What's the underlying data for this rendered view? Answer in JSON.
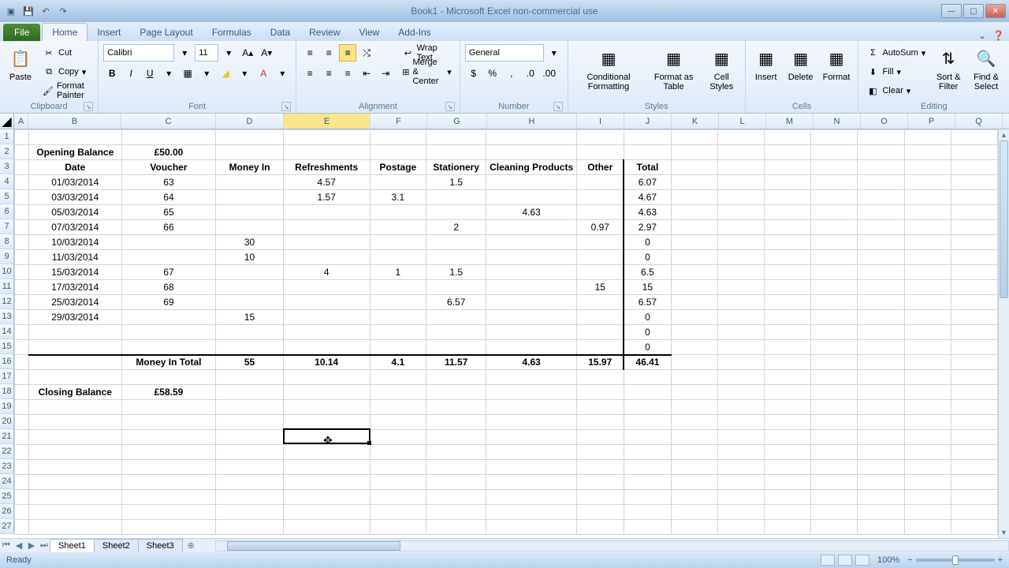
{
  "title": "Book1 - Microsoft Excel non-commercial use",
  "tabs": {
    "file": "File",
    "home": "Home",
    "insert": "Insert",
    "pageLayout": "Page Layout",
    "formulas": "Formulas",
    "data": "Data",
    "review": "Review",
    "view": "View",
    "addins": "Add-Ins"
  },
  "ribbon": {
    "clipboard": {
      "paste": "Paste",
      "cut": "Cut",
      "copy": "Copy",
      "painter": "Format Painter",
      "label": "Clipboard"
    },
    "font": {
      "name": "Calibri",
      "size": "11",
      "label": "Font"
    },
    "alignment": {
      "wrap": "Wrap Text",
      "merge": "Merge & Center",
      "label": "Alignment"
    },
    "number": {
      "format": "General",
      "label": "Number"
    },
    "styles": {
      "cond": "Conditional Formatting",
      "table": "Format as Table",
      "cell": "Cell Styles",
      "label": "Styles"
    },
    "cells": {
      "insert": "Insert",
      "delete": "Delete",
      "format": "Format",
      "label": "Cells"
    },
    "editing": {
      "autosum": "AutoSum",
      "fill": "Fill",
      "clear": "Clear",
      "sort": "Sort & Filter",
      "find": "Find & Select",
      "label": "Editing"
    }
  },
  "cols": [
    "A",
    "B",
    "C",
    "D",
    "E",
    "F",
    "G",
    "H",
    "I",
    "J",
    "K",
    "L",
    "M",
    "N",
    "O",
    "P",
    "Q"
  ],
  "rows": 27,
  "selectedCol": "E",
  "selectedCell": "E21",
  "sheet": {
    "B2": "Opening Balance",
    "C2": "£50.00",
    "B3": "Date",
    "C3": "Voucher",
    "D3": "Money In",
    "E3": "Refreshments",
    "F3": "Postage",
    "G3": "Stationery",
    "H3": "Cleaning Products",
    "I3": "Other",
    "J3": "Total",
    "B4": "01/03/2014",
    "C4": "63",
    "E4": "4.57",
    "G4": "1.5",
    "J4": "6.07",
    "B5": "03/03/2014",
    "C5": "64",
    "E5": "1.57",
    "F5": "3.1",
    "J5": "4.67",
    "B6": "05/03/2014",
    "C6": "65",
    "H6": "4.63",
    "J6": "4.63",
    "B7": "07/03/2014",
    "C7": "66",
    "G7": "2",
    "I7": "0.97",
    "J7": "2.97",
    "B8": "10/03/2014",
    "D8": "30",
    "J8": "0",
    "B9": "11/03/2014",
    "D9": "10",
    "J9": "0",
    "B10": "15/03/2014",
    "C10": "67",
    "E10": "4",
    "F10": "1",
    "G10": "1.5",
    "J10": "6.5",
    "B11": "17/03/2014",
    "C11": "68",
    "I11": "15",
    "J11": "15",
    "B12": "25/03/2014",
    "C12": "69",
    "G12": "6.57",
    "J12": "6.57",
    "B13": "29/03/2014",
    "D13": "15",
    "J13": "0",
    "J14": "0",
    "J15": "0",
    "C16": "Money In Total",
    "D16": "55",
    "E16": "10.14",
    "F16": "4.1",
    "G16": "11.57",
    "H16": "4.63",
    "I16": "15.97",
    "J16": "46.41",
    "B18": "Closing Balance",
    "C18": "£58.59"
  },
  "bold": [
    "B2",
    "C2",
    "B3",
    "C3",
    "D3",
    "E3",
    "F3",
    "G3",
    "H3",
    "I3",
    "J3",
    "C16",
    "D16",
    "E16",
    "F16",
    "G16",
    "H16",
    "I16",
    "J16",
    "B18",
    "C18"
  ],
  "sheets": [
    "Sheet1",
    "Sheet2",
    "Sheet3"
  ],
  "status": {
    "ready": "Ready",
    "zoom": "100%"
  }
}
